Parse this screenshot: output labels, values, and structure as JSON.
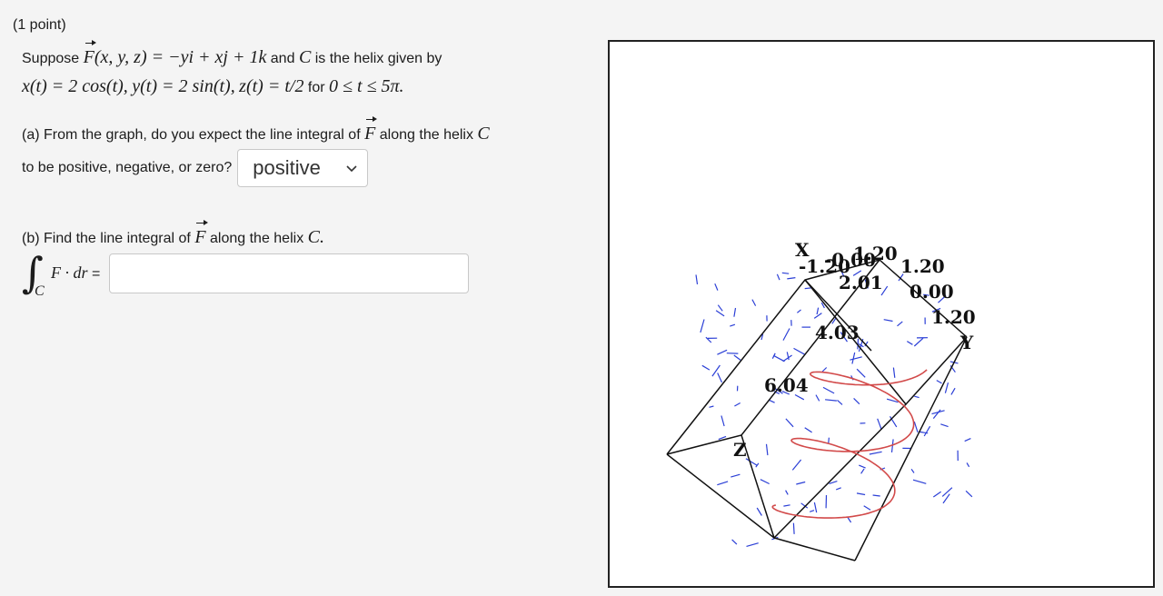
{
  "point_label": "(1 point)",
  "problem": {
    "suppose": "Suppose",
    "field_expr": "(x, y, z) = −yi + xj + 1k",
    "and_text": "and",
    "curve": "C",
    "is_helix_text": "is the helix given by",
    "param_x": "x(t) = 2 cos(t),",
    "param_y": "y(t) = 2 sin(t),",
    "param_z": "z(t) = t/2",
    "for_text": "for",
    "range": "0 ≤ t ≤ 5π.",
    "F": "F"
  },
  "part_a": {
    "text_1": "(a) From the graph, do you expect the line integral of",
    "text_2": "along the helix",
    "text_3": "to be positive, negative, or zero?",
    "selected": "positive"
  },
  "part_b": {
    "text_1": "(b) Find the line integral of",
    "text_2": "along the helix",
    "curve_end": "C.",
    "integral_sub": "C",
    "integral_expr": "F · dr",
    "equals": "=",
    "answer_value": ""
  },
  "graph": {
    "tick_labels": [
      "-1.20",
      "-0.00",
      "1.20",
      "2.01",
      "4.03",
      "6.04",
      "1.20",
      "0.00",
      "1.20"
    ],
    "axis_labels": {
      "x": "X",
      "y": "Y",
      "z": "Z"
    },
    "colors": {
      "helix": "#d24a4a",
      "field": "#2b3fd6",
      "frame": "#111111"
    }
  }
}
